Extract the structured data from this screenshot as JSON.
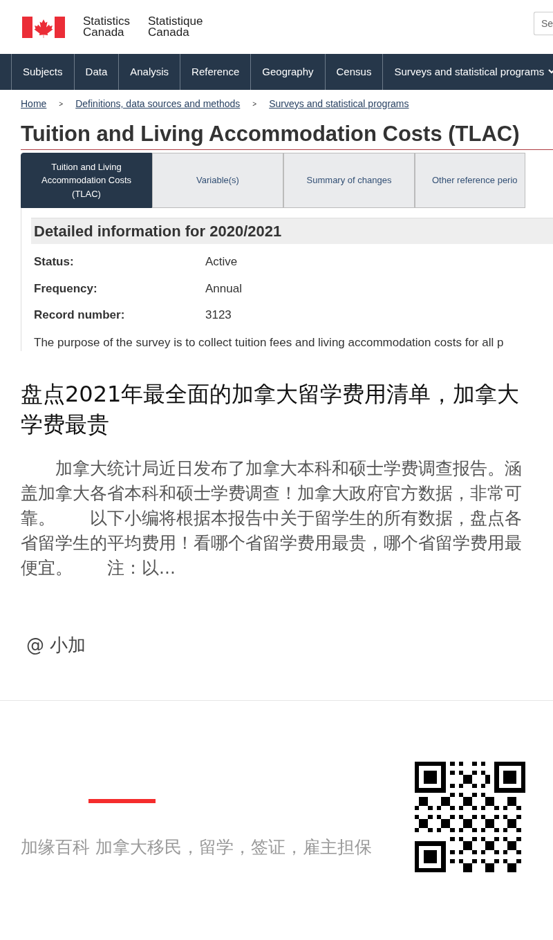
{
  "screenshot": {
    "signature": {
      "en": "Statistics Canada",
      "fr": "Statistique Canada"
    },
    "search": {
      "placeholder": "Se"
    },
    "nav": [
      {
        "label": "Subjects",
        "dropdown": false
      },
      {
        "label": "Data",
        "dropdown": false
      },
      {
        "label": "Analysis",
        "dropdown": false
      },
      {
        "label": "Reference",
        "dropdown": false
      },
      {
        "label": "Geography",
        "dropdown": false
      },
      {
        "label": "Census",
        "dropdown": false
      },
      {
        "label": "Surveys and statistical programs",
        "dropdown": true
      }
    ],
    "breadcrumb": {
      "separator": ">",
      "items": [
        "Home",
        "Definitions, data sources and methods",
        "Surveys and statistical programs"
      ]
    },
    "title": "Tuition and Living Accommodation Costs (TLAC)",
    "tabs": [
      {
        "label": "Tuition and Living Accommodation Costs (TLAC)",
        "selected": true
      },
      {
        "label": "Variable(s)",
        "selected": false
      },
      {
        "label": "Summary of changes",
        "selected": false
      },
      {
        "label": "Other reference perio",
        "selected": false
      }
    ],
    "details": {
      "heading": "Detailed information for 2020/2021",
      "fields": [
        {
          "label": "Status:",
          "value": "Active"
        },
        {
          "label": "Frequency:",
          "value": "Annual"
        },
        {
          "label": "Record number:",
          "value": "3123"
        }
      ],
      "description": "The purpose of the survey is to collect tuition fees and living accommodation costs for all p"
    }
  },
  "article": {
    "title": "盘点2021年最全面的加拿大留学费用清单，加拿大学费最贵",
    "excerpt": "　　加拿大统计局近日发布了加拿大本科和硕士学费调查报告。涵盖加拿大各省本科和硕士学费调查！加拿大政府官方数据，非常可靠。　　以下小编将根据本报告中关于留学生的所有数据，盘点各省留学生的平均费用！看哪个省留学费用最贵，哪个省留学费用最便宜。　　注：以...",
    "author": "@ 小加"
  },
  "footer": {
    "text": "加缘百科 加拿大移民，留学，签证，雇主担保"
  }
}
